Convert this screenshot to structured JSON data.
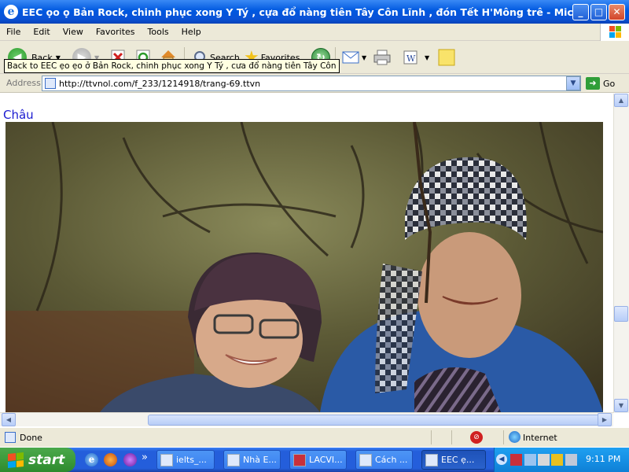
{
  "window": {
    "title": "EEC ọo ọ Bản Rock, chinh phục xong Y Tý , cựa đổ nàng tiên Tây Côn Lĩnh , đón Tết H'Mông trê - Microsoft I...",
    "minimize": "_",
    "maximize": "□",
    "close": "✕"
  },
  "menu": [
    "File",
    "Edit",
    "View",
    "Favorites",
    "Tools",
    "Help"
  ],
  "toolbar": {
    "back_label": "Back",
    "search_label": "Search",
    "favorites_label": "Favorites"
  },
  "tooltip": "Back to EEC ẹo ẹo ở Bản Rock, chinh phục xong Y Tý , cưa đổ nàng tiên Tây Côn",
  "address": {
    "label": "Address",
    "url": "http://ttvnol.com/f_233/1214918/trang-69.ttvn",
    "go_label": "Go"
  },
  "page": {
    "text": "Châu"
  },
  "status": {
    "text": "Done",
    "zone": "Internet"
  },
  "taskbar": {
    "start_label": "start",
    "chevron": "»",
    "tasks": [
      {
        "label": "ielts_..."
      },
      {
        "label": "Nhà E..."
      },
      {
        "label": "LACVI..."
      },
      {
        "label": "Cách ..."
      },
      {
        "label": "EEC ẹ..."
      }
    ],
    "clock": "9:11 PM"
  },
  "colors": {
    "titlebar": "#0058e0",
    "chrome": "#ece9d8",
    "link": "#1a1ad0",
    "start": "#3c9b3c",
    "taskbar": "#245edb"
  }
}
